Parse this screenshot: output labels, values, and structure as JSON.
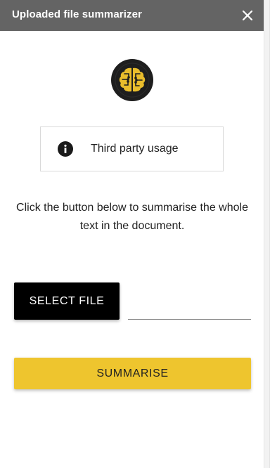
{
  "header": {
    "title": "Uploaded file summarizer",
    "close_icon": "close-icon"
  },
  "logo": {
    "icon": "brain-circuit-icon",
    "colors": {
      "ring": "#1e1e1e",
      "brain": "#e9bd2c",
      "lines": "#1e1e1e"
    }
  },
  "usage_notice": {
    "icon": "info-icon",
    "label": "Third party usage"
  },
  "instructions": {
    "text": "Click the button below to summarise the whole text in the document."
  },
  "file_picker": {
    "button_label": "SELECT FILE",
    "selected_value": ""
  },
  "actions": {
    "summarise_label": "SUMMARISE"
  },
  "colors": {
    "header_bg": "#646464",
    "accent": "#eec52e",
    "primary_button_bg": "#000000"
  }
}
